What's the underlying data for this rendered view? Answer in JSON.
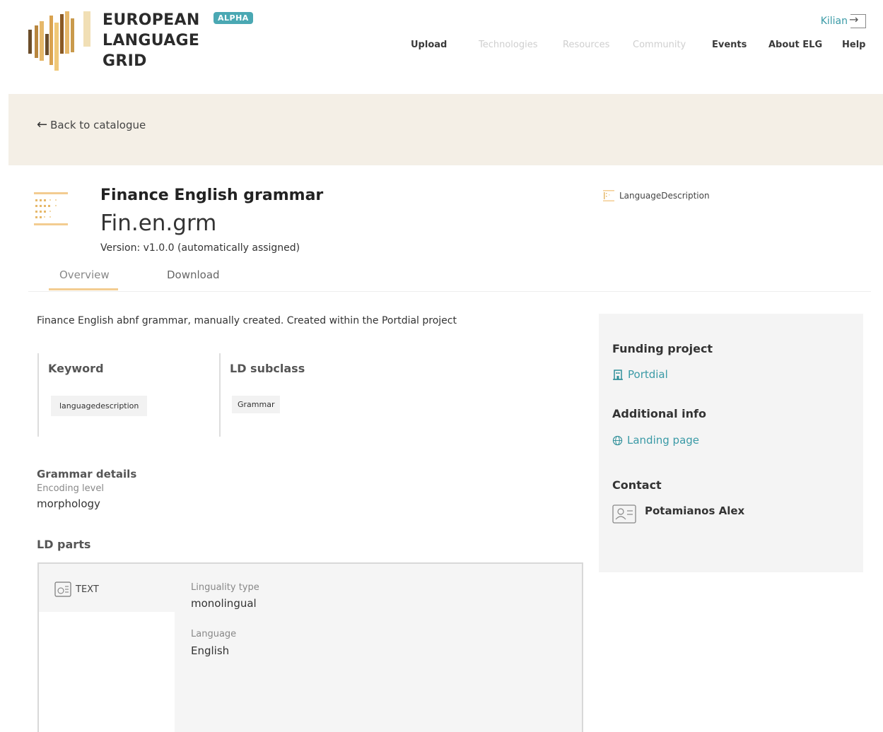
{
  "header": {
    "logo_lines": [
      "EUROPEAN",
      "LANGUAGE",
      "GRID"
    ],
    "badge": "ALPHA",
    "nav": [
      {
        "label": "Upload",
        "enabled": true
      },
      {
        "label": "Technologies",
        "enabled": false
      },
      {
        "label": "Resources",
        "enabled": false
      },
      {
        "label": "Community",
        "enabled": false
      },
      {
        "label": "Events",
        "enabled": true
      },
      {
        "label": "About ELG",
        "enabled": true
      },
      {
        "label": "Help",
        "enabled": true
      }
    ],
    "user": "Kilian"
  },
  "back_link": "Back to catalogue",
  "resource": {
    "title": "Finance English grammar",
    "short_name": "Fin.en.grm",
    "version": "Version: v1.0.0 (automatically assigned)",
    "type_tag": "LanguageDescription"
  },
  "tabs": [
    {
      "label": "Overview",
      "active": true
    },
    {
      "label": "Download",
      "active": false
    }
  ],
  "overview": {
    "description": "Finance English abnf grammar, manually created. Created within the Portdial project",
    "keyword_title": "Keyword",
    "keyword_values": [
      "languagedescription"
    ],
    "ld_subclass_title": "LD subclass",
    "ld_subclass_values": [
      "Grammar"
    ],
    "grammar_details": {
      "title": "Grammar details",
      "label": "Encoding level",
      "value": "morphology"
    },
    "ld_parts": {
      "title": "LD parts",
      "part_label": "TEXT",
      "fields": [
        {
          "label": "Linguality type",
          "value": "monolingual"
        },
        {
          "label": "Language",
          "value": "English"
        }
      ]
    }
  },
  "sidebar": {
    "funding_title": "Funding project",
    "funding_link": "Portdial",
    "additional_title": "Additional info",
    "additional_link": "Landing page",
    "contact_title": "Contact",
    "contact_name": "Potamianos Alex"
  },
  "colors": {
    "accent": "#3a9aa6",
    "band": "#f4efe6",
    "logo_gold": "#e6b86a",
    "logo_dark": "#6b4d2a",
    "tab_underline": "#f3cc91"
  }
}
